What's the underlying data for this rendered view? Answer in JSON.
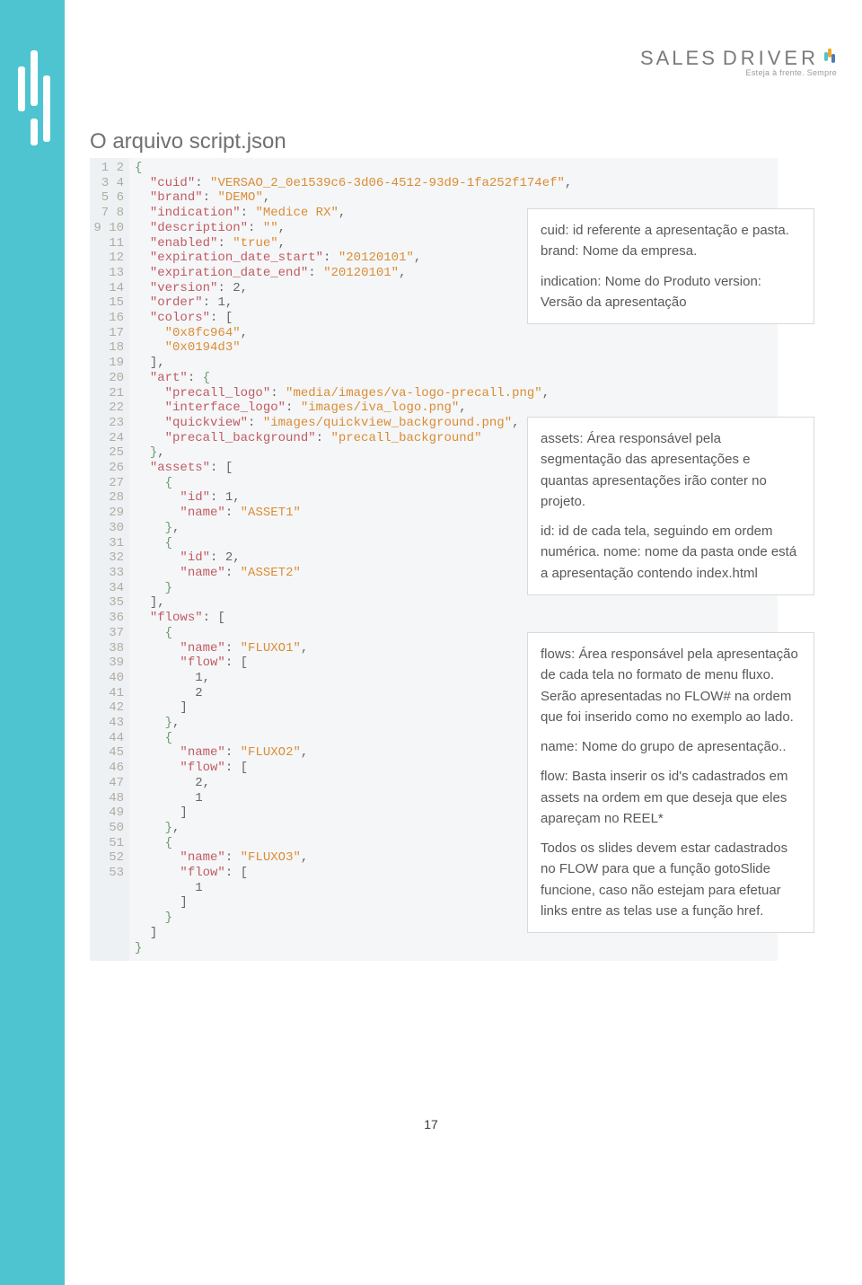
{
  "brand": {
    "word1": "SALES",
    "word2": "DRIVER",
    "tagline": "Esteja à frente. Sempre"
  },
  "title": "O arquivo script.json",
  "code": {
    "lines": [
      [
        {
          "t": "brace",
          "v": "{"
        }
      ],
      [
        {
          "t": "ind",
          "v": "  "
        },
        {
          "t": "key",
          "v": "\"cuid\""
        },
        {
          "t": "punc",
          "v": ": "
        },
        {
          "t": "str",
          "v": "\"VERSAO_2_0e1539c6-3d06-4512-93d9-1fa252f174ef\""
        },
        {
          "t": "punc",
          "v": ","
        }
      ],
      [
        {
          "t": "ind",
          "v": "  "
        },
        {
          "t": "key",
          "v": "\"brand\""
        },
        {
          "t": "punc",
          "v": ": "
        },
        {
          "t": "str",
          "v": "\"DEMO\""
        },
        {
          "t": "punc",
          "v": ","
        }
      ],
      [
        {
          "t": "ind",
          "v": "  "
        },
        {
          "t": "key",
          "v": "\"indication\""
        },
        {
          "t": "punc",
          "v": ": "
        },
        {
          "t": "str",
          "v": "\"Medice RX\""
        },
        {
          "t": "punc",
          "v": ","
        }
      ],
      [
        {
          "t": "ind",
          "v": "  "
        },
        {
          "t": "key",
          "v": "\"description\""
        },
        {
          "t": "punc",
          "v": ": "
        },
        {
          "t": "str",
          "v": "\"\""
        },
        {
          "t": "punc",
          "v": ","
        }
      ],
      [
        {
          "t": "ind",
          "v": "  "
        },
        {
          "t": "key",
          "v": "\"enabled\""
        },
        {
          "t": "punc",
          "v": ": "
        },
        {
          "t": "str",
          "v": "\"true\""
        },
        {
          "t": "punc",
          "v": ","
        }
      ],
      [
        {
          "t": "ind",
          "v": "  "
        },
        {
          "t": "key",
          "v": "\"expiration_date_start\""
        },
        {
          "t": "punc",
          "v": ": "
        },
        {
          "t": "str",
          "v": "\"20120101\""
        },
        {
          "t": "punc",
          "v": ","
        }
      ],
      [
        {
          "t": "ind",
          "v": "  "
        },
        {
          "t": "key",
          "v": "\"expiration_date_end\""
        },
        {
          "t": "punc",
          "v": ": "
        },
        {
          "t": "str",
          "v": "\"20120101\""
        },
        {
          "t": "punc",
          "v": ","
        }
      ],
      [
        {
          "t": "ind",
          "v": "  "
        },
        {
          "t": "key",
          "v": "\"version\""
        },
        {
          "t": "punc",
          "v": ": "
        },
        {
          "t": "num",
          "v": "2"
        },
        {
          "t": "punc",
          "v": ","
        }
      ],
      [
        {
          "t": "ind",
          "v": "  "
        },
        {
          "t": "key",
          "v": "\"order\""
        },
        {
          "t": "punc",
          "v": ": "
        },
        {
          "t": "num",
          "v": "1"
        },
        {
          "t": "punc",
          "v": ","
        }
      ],
      [
        {
          "t": "ind",
          "v": "  "
        },
        {
          "t": "key",
          "v": "\"colors\""
        },
        {
          "t": "punc",
          "v": ": ["
        }
      ],
      [
        {
          "t": "ind",
          "v": "    "
        },
        {
          "t": "str",
          "v": "\"0x8fc964\""
        },
        {
          "t": "punc",
          "v": ","
        }
      ],
      [
        {
          "t": "ind",
          "v": "    "
        },
        {
          "t": "str",
          "v": "\"0x0194d3\""
        }
      ],
      [
        {
          "t": "ind",
          "v": "  "
        },
        {
          "t": "punc",
          "v": "],"
        }
      ],
      [
        {
          "t": "ind",
          "v": "  "
        },
        {
          "t": "key",
          "v": "\"art\""
        },
        {
          "t": "punc",
          "v": ": "
        },
        {
          "t": "brace",
          "v": "{"
        }
      ],
      [
        {
          "t": "ind",
          "v": "    "
        },
        {
          "t": "key",
          "v": "\"precall_logo\""
        },
        {
          "t": "punc",
          "v": ": "
        },
        {
          "t": "str",
          "v": "\"media/images/va-logo-precall.png\""
        },
        {
          "t": "punc",
          "v": ","
        }
      ],
      [
        {
          "t": "ind",
          "v": "    "
        },
        {
          "t": "key",
          "v": "\"interface_logo\""
        },
        {
          "t": "punc",
          "v": ": "
        },
        {
          "t": "str",
          "v": "\"images/iva_logo.png\""
        },
        {
          "t": "punc",
          "v": ","
        }
      ],
      [
        {
          "t": "ind",
          "v": "    "
        },
        {
          "t": "key",
          "v": "\"quickview\""
        },
        {
          "t": "punc",
          "v": ": "
        },
        {
          "t": "str",
          "v": "\"images/quickview_background.png\""
        },
        {
          "t": "punc",
          "v": ","
        }
      ],
      [
        {
          "t": "ind",
          "v": "    "
        },
        {
          "t": "key",
          "v": "\"precall_background\""
        },
        {
          "t": "punc",
          "v": ": "
        },
        {
          "t": "str",
          "v": "\"precall_background\""
        }
      ],
      [
        {
          "t": "ind",
          "v": "  "
        },
        {
          "t": "brace",
          "v": "}"
        },
        {
          "t": "punc",
          "v": ","
        }
      ],
      [
        {
          "t": "ind",
          "v": "  "
        },
        {
          "t": "key",
          "v": "\"assets\""
        },
        {
          "t": "punc",
          "v": ": ["
        }
      ],
      [
        {
          "t": "ind",
          "v": "    "
        },
        {
          "t": "brace",
          "v": "{"
        }
      ],
      [
        {
          "t": "ind",
          "v": "      "
        },
        {
          "t": "key",
          "v": "\"id\""
        },
        {
          "t": "punc",
          "v": ": "
        },
        {
          "t": "num",
          "v": "1"
        },
        {
          "t": "punc",
          "v": ","
        }
      ],
      [
        {
          "t": "ind",
          "v": "      "
        },
        {
          "t": "key",
          "v": "\"name\""
        },
        {
          "t": "punc",
          "v": ": "
        },
        {
          "t": "str",
          "v": "\"ASSET1\""
        }
      ],
      [
        {
          "t": "ind",
          "v": "    "
        },
        {
          "t": "brace",
          "v": "}"
        },
        {
          "t": "punc",
          "v": ","
        }
      ],
      [
        {
          "t": "ind",
          "v": "    "
        },
        {
          "t": "brace",
          "v": "{"
        }
      ],
      [
        {
          "t": "ind",
          "v": "      "
        },
        {
          "t": "key",
          "v": "\"id\""
        },
        {
          "t": "punc",
          "v": ": "
        },
        {
          "t": "num",
          "v": "2"
        },
        {
          "t": "punc",
          "v": ","
        }
      ],
      [
        {
          "t": "ind",
          "v": "      "
        },
        {
          "t": "key",
          "v": "\"name\""
        },
        {
          "t": "punc",
          "v": ": "
        },
        {
          "t": "str",
          "v": "\"ASSET2\""
        }
      ],
      [
        {
          "t": "ind",
          "v": "    "
        },
        {
          "t": "brace",
          "v": "}"
        }
      ],
      [
        {
          "t": "ind",
          "v": "  "
        },
        {
          "t": "punc",
          "v": "],"
        }
      ],
      [
        {
          "t": "ind",
          "v": "  "
        },
        {
          "t": "key",
          "v": "\"flows\""
        },
        {
          "t": "punc",
          "v": ": ["
        }
      ],
      [
        {
          "t": "ind",
          "v": "    "
        },
        {
          "t": "brace",
          "v": "{"
        }
      ],
      [
        {
          "t": "ind",
          "v": "      "
        },
        {
          "t": "key",
          "v": "\"name\""
        },
        {
          "t": "punc",
          "v": ": "
        },
        {
          "t": "str",
          "v": "\"FLUXO1\""
        },
        {
          "t": "punc",
          "v": ","
        }
      ],
      [
        {
          "t": "ind",
          "v": "      "
        },
        {
          "t": "key",
          "v": "\"flow\""
        },
        {
          "t": "punc",
          "v": ": ["
        }
      ],
      [
        {
          "t": "ind",
          "v": "        "
        },
        {
          "t": "num",
          "v": "1"
        },
        {
          "t": "punc",
          "v": ","
        }
      ],
      [
        {
          "t": "ind",
          "v": "        "
        },
        {
          "t": "num",
          "v": "2"
        }
      ],
      [
        {
          "t": "ind",
          "v": "      "
        },
        {
          "t": "punc",
          "v": "]"
        }
      ],
      [
        {
          "t": "ind",
          "v": "    "
        },
        {
          "t": "brace",
          "v": "}"
        },
        {
          "t": "punc",
          "v": ","
        }
      ],
      [
        {
          "t": "ind",
          "v": "    "
        },
        {
          "t": "brace",
          "v": "{"
        }
      ],
      [
        {
          "t": "ind",
          "v": "      "
        },
        {
          "t": "key",
          "v": "\"name\""
        },
        {
          "t": "punc",
          "v": ": "
        },
        {
          "t": "str",
          "v": "\"FLUXO2\""
        },
        {
          "t": "punc",
          "v": ","
        }
      ],
      [
        {
          "t": "ind",
          "v": "      "
        },
        {
          "t": "key",
          "v": "\"flow\""
        },
        {
          "t": "punc",
          "v": ": ["
        }
      ],
      [
        {
          "t": "ind",
          "v": "        "
        },
        {
          "t": "num",
          "v": "2"
        },
        {
          "t": "punc",
          "v": ","
        }
      ],
      [
        {
          "t": "ind",
          "v": "        "
        },
        {
          "t": "num",
          "v": "1"
        }
      ],
      [
        {
          "t": "ind",
          "v": "      "
        },
        {
          "t": "punc",
          "v": "]"
        }
      ],
      [
        {
          "t": "ind",
          "v": "    "
        },
        {
          "t": "brace",
          "v": "}"
        },
        {
          "t": "punc",
          "v": ","
        }
      ],
      [
        {
          "t": "ind",
          "v": "    "
        },
        {
          "t": "brace",
          "v": "{"
        }
      ],
      [
        {
          "t": "ind",
          "v": "      "
        },
        {
          "t": "key",
          "v": "\"name\""
        },
        {
          "t": "punc",
          "v": ": "
        },
        {
          "t": "str",
          "v": "\"FLUXO3\""
        },
        {
          "t": "punc",
          "v": ","
        }
      ],
      [
        {
          "t": "ind",
          "v": "      "
        },
        {
          "t": "key",
          "v": "\"flow\""
        },
        {
          "t": "punc",
          "v": ": ["
        }
      ],
      [
        {
          "t": "ind",
          "v": "        "
        },
        {
          "t": "num",
          "v": "1"
        }
      ],
      [
        {
          "t": "ind",
          "v": "      "
        },
        {
          "t": "punc",
          "v": "]"
        }
      ],
      [
        {
          "t": "ind",
          "v": "    "
        },
        {
          "t": "brace",
          "v": "}"
        }
      ],
      [
        {
          "t": "ind",
          "v": "  "
        },
        {
          "t": "punc",
          "v": "]"
        }
      ],
      [
        {
          "t": "brace",
          "v": "}"
        }
      ]
    ]
  },
  "annotations": {
    "a1": {
      "p1": "cuid: id referente a apresentação e pasta. brand: Nome da empresa.",
      "p2": "indication: Nome do Produto version: Versão da apresentação"
    },
    "a2": {
      "p1": "assets: Área responsável pela segmentação das apresentações e quantas apresentações irão conter no projeto.",
      "p2": "id: id de cada tela, seguindo em ordem numérica. nome: nome da pasta onde está a apresentação contendo index.html"
    },
    "a3": {
      "p1": "flows: Área responsável pela apresentação de cada tela no formato de menu fluxo. Serão apresentadas no FLOW# na ordem que foi inserido como no exemplo ao lado.",
      "p2": "name: Nome do grupo de apresentação..",
      "p3": "flow: Basta inserir os id's cadastrados em assets na ordem em que deseja que eles apareçam no REEL*",
      "p4": "Todos os slides devem estar cadastrados no FLOW para que a função gotoSlide funcione, caso não estejam para efetuar links entre as telas use a função href."
    }
  },
  "page_number": "17"
}
